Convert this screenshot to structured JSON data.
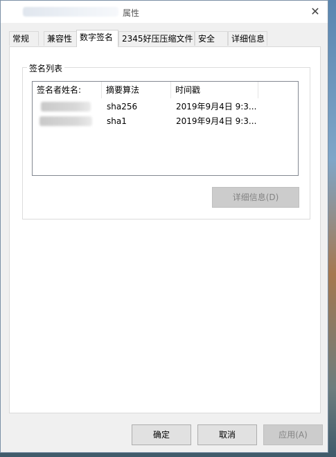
{
  "window": {
    "title_suffix": "属性",
    "close_glyph": "✕"
  },
  "tabs": [
    {
      "label": "常规"
    },
    {
      "label": "兼容性"
    },
    {
      "label": "数字签名",
      "active": true
    },
    {
      "label": "2345好压压缩文件"
    },
    {
      "label": "安全"
    },
    {
      "label": "详细信息"
    }
  ],
  "signature_group": {
    "legend": "签名列表",
    "columns": [
      "签名者姓名:",
      "摘要算法",
      "时间戳"
    ],
    "rows": [
      {
        "algorithm": "sha256",
        "timestamp": "2019年9月4日 9:3..."
      },
      {
        "algorithm": "sha1",
        "timestamp": "2019年9月4日 9:3..."
      }
    ],
    "details_button": "详细信息(D)"
  },
  "footer": {
    "ok": "确定",
    "cancel": "取消",
    "apply": "应用(A)"
  },
  "colors": {
    "dialog_bg": "#f0f0f0",
    "panel_bg": "#ffffff",
    "disabled_text": "#838383"
  }
}
